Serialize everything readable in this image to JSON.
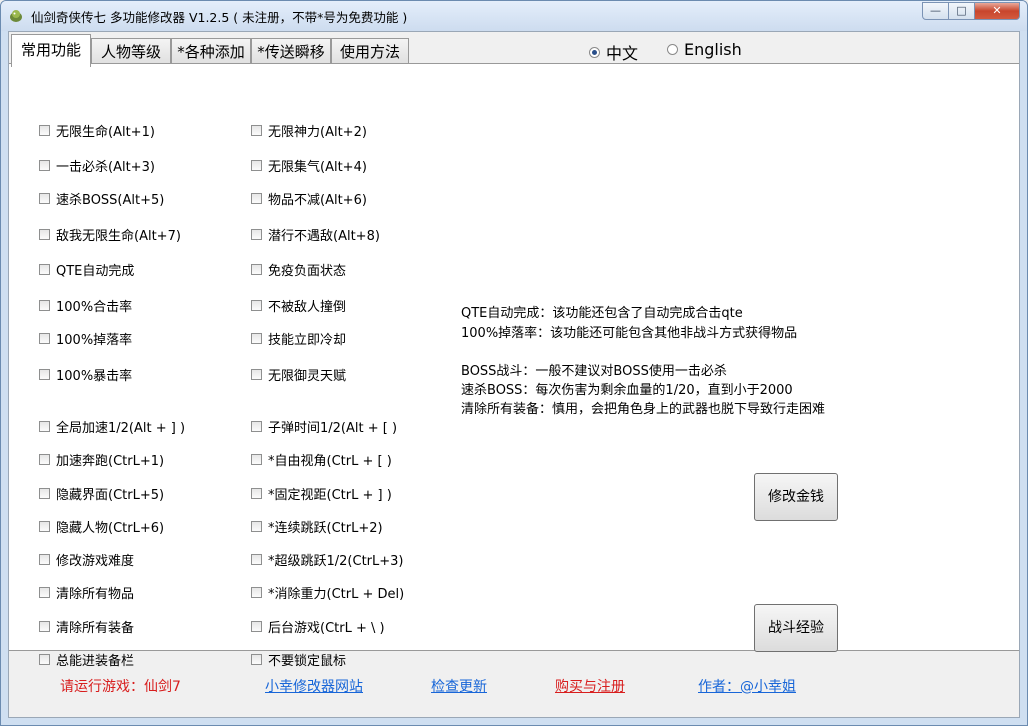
{
  "window": {
    "title": "仙剑奇侠传七 多功能修改器  V1.2.5 ( 未注册，不带*号为免费功能 )",
    "controls": {
      "minimize": "—",
      "maximize": "□",
      "close": "✕"
    }
  },
  "tabs": [
    {
      "label": "常用功能",
      "active": true
    },
    {
      "label": "人物等级",
      "active": false
    },
    {
      "label": "*各种添加",
      "active": false
    },
    {
      "label": "*传送瞬移",
      "active": false
    },
    {
      "label": "使用方法",
      "active": false
    }
  ],
  "language": {
    "options": [
      {
        "label": "中文",
        "selected": true
      },
      {
        "label": "English",
        "selected": false
      }
    ]
  },
  "left_column": [
    "无限生命(Alt+1)",
    "一击必杀(Alt+3)",
    "速杀BOSS(Alt+5)",
    "敌我无限生命(Alt+7)",
    "QTE自动完成",
    "100%合击率",
    "100%掉落率",
    "100%暴击率",
    "全局加速1/2(Alt + ] )",
    "加速奔跑(CtrL+1)",
    "隐藏界面(CtrL+5)",
    "隐藏人物(CtrL+6)",
    "修改游戏难度",
    "清除所有物品",
    "清除所有装备",
    "总能进装备栏"
  ],
  "right_column": [
    "无限神力(Alt+2)",
    "无限集气(Alt+4)",
    "物品不减(Alt+6)",
    "潜行不遇敌(Alt+8)",
    "免疫负面状态",
    "不被敌人撞倒",
    "技能立即冷却",
    "无限御灵天赋",
    "子弹时间1/2(Alt + [ )",
    "*自由视角(CtrL + [ )",
    "*固定视距(CtrL + ] )",
    "*连续跳跃(CtrL+2)",
    "*超级跳跃1/2(CtrL+3)",
    "*消除重力(CtrL + Del)",
    "后台游戏(CtrL + \\ )",
    "不要锁定鼠标"
  ],
  "info_lines": [
    "QTE自动完成：该功能还包含了自动完成合击qte",
    "100%掉落率：该功能还可能包含其他非战斗方式获得物品",
    "BOSS战斗：一般不建议对BOSS使用一击必杀",
    "速杀BOSS：每次伤害为剩余血量的1/20，直到小于2000",
    "清除所有装备：慎用，会把角色身上的武器也脱下导致行走困难"
  ],
  "buttons": {
    "money": "修改金钱",
    "exp": "战斗经验"
  },
  "footer": {
    "status": "请运行游戏：仙剑7",
    "website": "小幸修改器网站",
    "update": "检查更新",
    "buy": "购买与注册",
    "author": "作者：@小幸姐"
  }
}
